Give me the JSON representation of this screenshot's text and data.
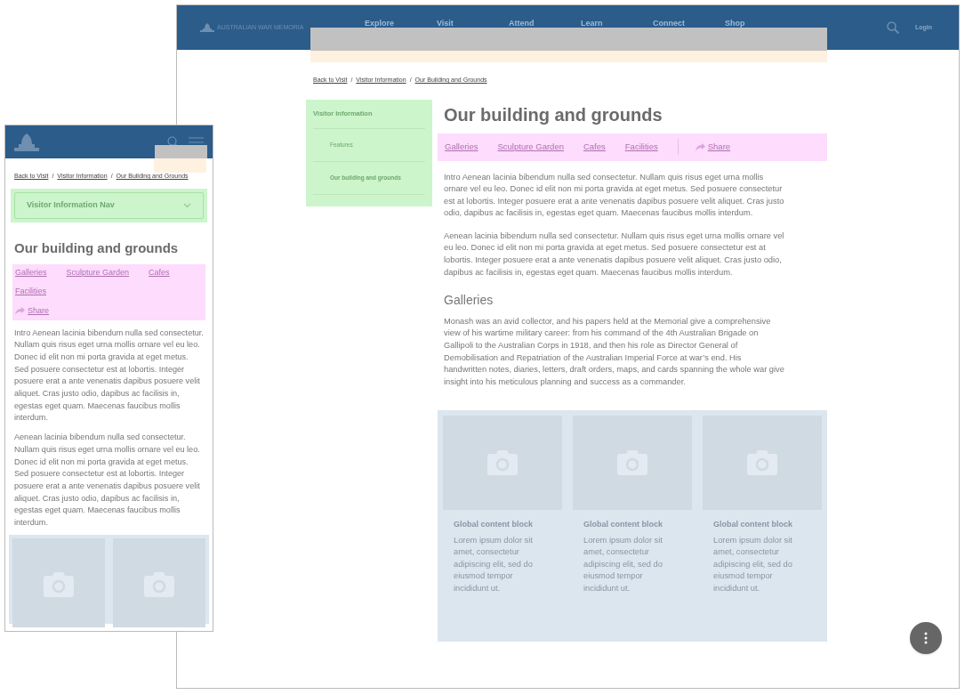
{
  "desktop": {
    "header": {
      "logo_text": "AUSTRALIAN WAR MEMORIA",
      "nav": [
        "Explore",
        "Visit",
        "Attend",
        "Learn",
        "Connect",
        "Shop"
      ],
      "login": "Login"
    },
    "breadcrumb": [
      "Back to Visit",
      "Visitor Information",
      "Our Building and Grounds"
    ],
    "breadcrumb_separator": "/",
    "sidenav": {
      "title": "Visitor Information",
      "items": [
        {
          "label": "Features",
          "selected": false
        },
        {
          "label": "Our building and grounds",
          "selected": true
        }
      ]
    },
    "title": "Our building and grounds",
    "anchor_links": [
      "Galleries",
      "Sculpture Garden",
      "Cafes",
      "Facilities"
    ],
    "share": "Share",
    "paragraphs": [
      "Intro Aenean lacinia bibendum nulla sed consectetur. Nullam quis risus eget urna mollis ornare vel eu leo. Donec id elit non mi porta gravida at eget metus. Sed posuere consectetur est at lobortis. Integer posuere erat a ante venenatis dapibus posuere velit aliquet. Cras justo odio, dapibus ac facilisis in, egestas eget quam. Maecenas faucibus mollis interdum.",
      "Aenean lacinia bibendum nulla sed consectetur. Nullam quis risus eget urna mollis ornare vel eu leo. Donec id elit non mi porta gravida at eget metus. Sed posuere consectetur est at lobortis. Integer posuere erat a ante venenatis dapibus posuere velit aliquet. Cras justo odio, dapibus ac facilisis in, egestas eget quam. Maecenas faucibus mollis interdum."
    ],
    "section_heading": "Galleries",
    "section_text": "Monash was an avid collector, and his papers held at the Memorial give a comprehensive view of his wartime military career: from his command of the 4th Australian Brigade on Gallipoli to the Australian Corps in 1918, and then his role as Director General of Demobilisation and Repatriation of the Australian Imperial Force at war’s end. His handwritten notes, diaries, letters, draft orders, maps, and cards spanning the whole war give insight into his meticulous planning and success as a commander.",
    "cards": [
      {
        "title": "Global content block",
        "text": "Lorem ipsum dolor sit amet, consectetur adipiscing elit, sed do eiusmod tempor incididunt ut."
      },
      {
        "title": "Global content block",
        "text": "Lorem ipsum dolor sit amet, consectetur adipiscing elit, sed do eiusmod tempor incididunt ut."
      },
      {
        "title": "Global content block",
        "text": "Lorem ipsum dolor sit amet, consectetur adipiscing elit, sed do eiusmod tempor incididunt ut."
      }
    ]
  },
  "mobile": {
    "breadcrumb": [
      "Back to Visit",
      "Visitor Information",
      "Our Building and Grounds"
    ],
    "breadcrumb_separator": "/",
    "nav_dropdown": "Visitor Information Nav",
    "title": "Our building and grounds",
    "anchor_links": [
      "Galleries",
      "Sculpture Garden",
      "Cafes",
      "Facilities"
    ],
    "share": "Share",
    "paragraphs": [
      "Intro Aenean lacinia bibendum nulla sed consectetur. Nullam quis risus eget urna mollis ornare vel eu leo. Donec id elit non mi porta gravida at eget metus. Sed posuere consectetur est at lobortis. Integer posuere erat a ante venenatis dapibus posuere velit aliquet. Cras justo odio, dapibus ac facilisis in, egestas eget quam. Maecenas faucibus mollis interdum.",
      "Aenean lacinia bibendum nulla sed consectetur. Nullam quis risus eget urna mollis ornare vel eu leo. Donec id elit non mi porta gravida at eget metus. Sed posuere consectetur est at lobortis. Integer posuere erat a ante venenatis dapibus posuere velit aliquet. Cras justo odio, dapibus ac facilisis in, egestas eget quam. Maecenas faucibus mollis interdum."
    ],
    "cards": [
      {
        "kind": "placeholder"
      },
      {
        "kind": "placeholder"
      }
    ]
  }
}
